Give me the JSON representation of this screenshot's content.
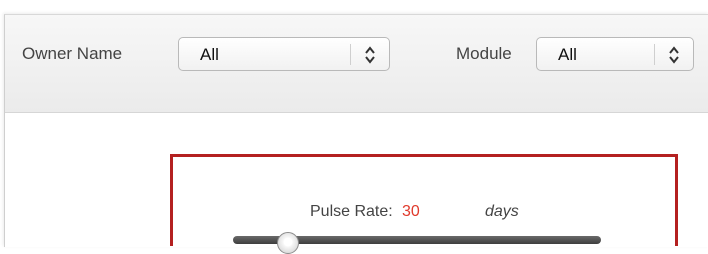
{
  "filters": {
    "owner_name": {
      "label": "Owner Name",
      "value": "All"
    },
    "module": {
      "label": "Module",
      "value": "All"
    }
  },
  "pulse_rate": {
    "label": "Pulse Rate:",
    "value": "30",
    "unit": "days",
    "slider_level": 0.15
  },
  "colors": {
    "highlight_border": "#b42020",
    "value_text": "#e03a2c"
  },
  "icons": {
    "select_arrows": "up-down-chevrons-icon"
  }
}
